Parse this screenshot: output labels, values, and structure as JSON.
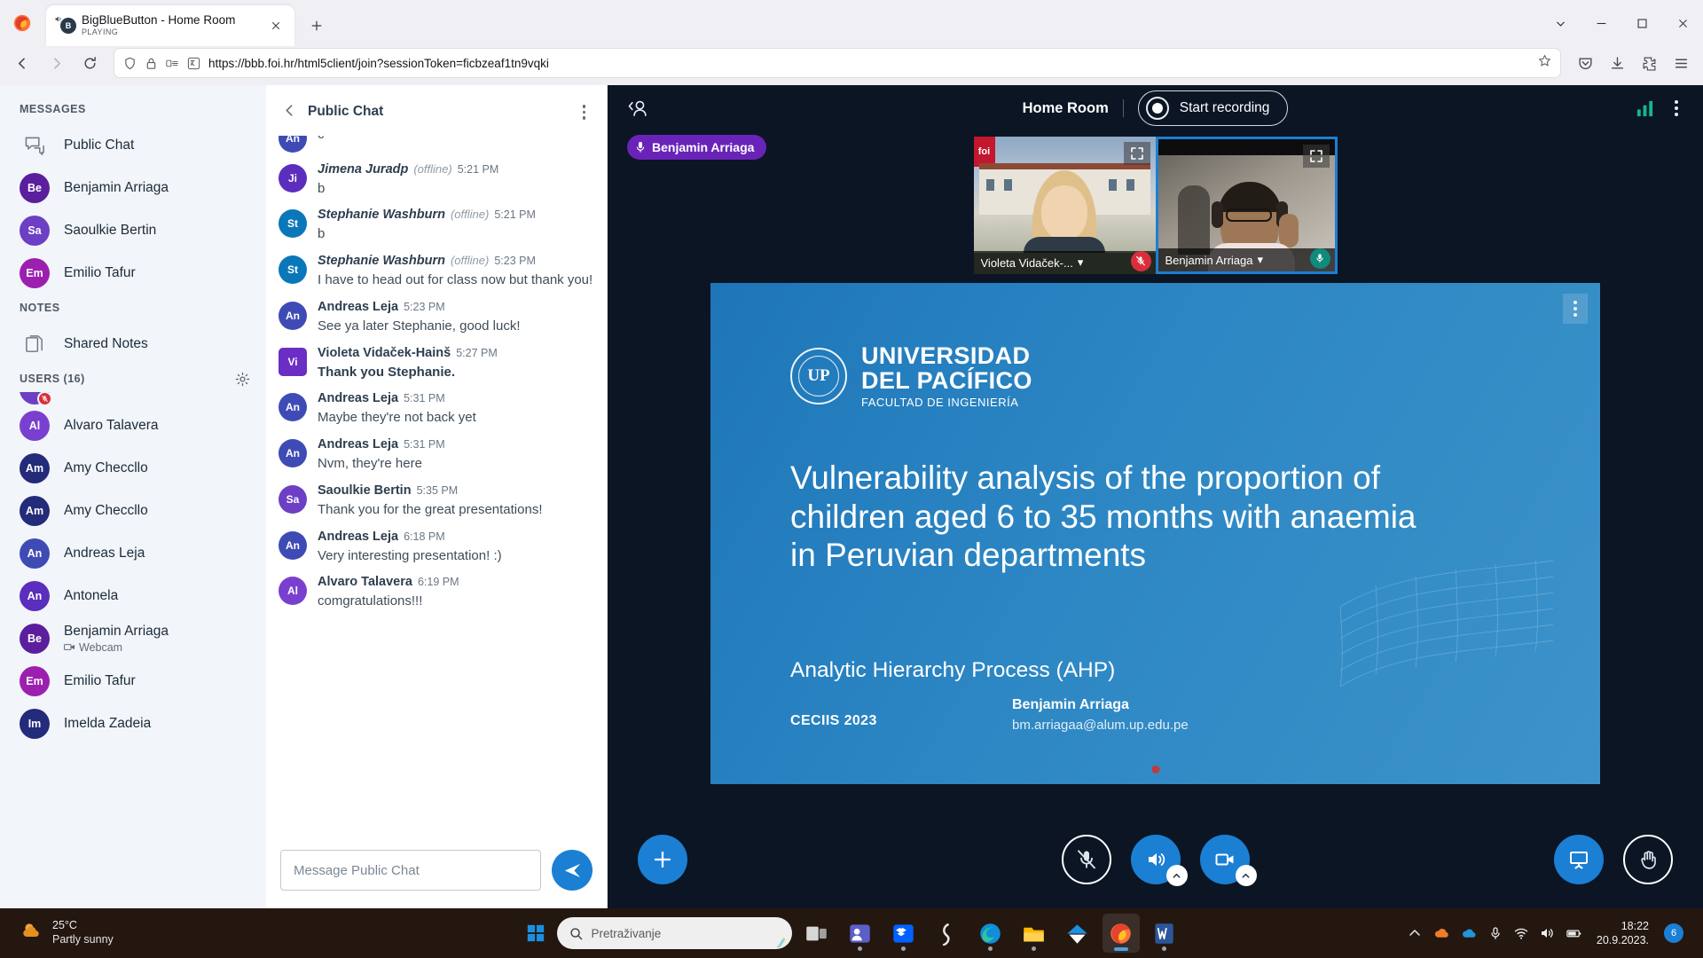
{
  "browser": {
    "tab": {
      "title": "BigBlueButton - Home Room",
      "status": "PLAYING",
      "favicon": "bbb-icon",
      "close": "close-icon"
    },
    "new_tab": "+",
    "window_controls": {
      "minimize": "minimize-icon",
      "maximize": "maximize-icon",
      "close": "close-icon",
      "tab_list": "chevron-down-icon"
    },
    "nav": {
      "back": "back-arrow-icon",
      "forward": "forward-arrow-icon",
      "reload": "reload-icon"
    },
    "url": "https://bbb.foi.hr/html5client/join?sessionToken=ficbzeaf1tn9vqki",
    "url_icons": {
      "shield": "shield-icon",
      "lock": "lock-icon",
      "extension": "extensions-icon",
      "translate": "translate-icon",
      "bookmark": "star-icon"
    },
    "toolbar_right": {
      "pocket": "save-to-pocket-icon",
      "downloads": "download-icon",
      "extensions": "puzzle-icon",
      "menu": "hamburger-menu-icon"
    }
  },
  "sidebar": {
    "messages_heading": "MESSAGES",
    "messages": [
      {
        "label": "Public Chat",
        "icon": "chat-bubbles-icon",
        "type": "icon"
      },
      {
        "label": "Benjamin Arriaga",
        "initials": "Be",
        "color": "#5b1f9e"
      },
      {
        "label": "Saoulkie Bertin",
        "initials": "Sa",
        "color": "#6c3fc4"
      },
      {
        "label": "Emilio Tafur",
        "initials": "Em",
        "color": "#9c1fb0"
      }
    ],
    "notes_heading": "NOTES",
    "notes": {
      "label": "Shared Notes",
      "icon": "documents-icon"
    },
    "users_heading": "USERS (16)",
    "users_settings_icon": "gear-icon",
    "users": [
      {
        "name": "",
        "initials": "",
        "color": "#6c3fc4",
        "status": "mute",
        "partial": true
      },
      {
        "name": "Alvaro Talavera",
        "initials": "Al",
        "color": "#7940cf",
        "status": "audio"
      },
      {
        "name": "Amy Checcllo",
        "initials": "Am",
        "color": "#232b7a",
        "status": "mute"
      },
      {
        "name": "Amy Checcllo",
        "initials": "Am",
        "color": "#232b7a",
        "status": "audio"
      },
      {
        "name": "Andreas Leja",
        "initials": "An",
        "color": "#3f4bb5",
        "status": "mute"
      },
      {
        "name": "Antonela",
        "initials": "An",
        "color": "#5b2ebd",
        "status": "mute"
      },
      {
        "name": "Benjamin Arriaga",
        "initials": "Be",
        "color": "#5b1f9e",
        "status": "audio",
        "presenter": true,
        "sub": "Webcam",
        "sub_icon": "webcam-icon"
      },
      {
        "name": "Emilio Tafur",
        "initials": "Em",
        "color": "#9c1fb0",
        "status": "mute"
      },
      {
        "name": "Imelda Zadeia",
        "initials": "Im",
        "color": "#232b7a",
        "status": "mute"
      }
    ]
  },
  "chat": {
    "back_icon": "chevron-left-icon",
    "title": "Public Chat",
    "options_icon": "kebab-menu-icon",
    "messages": [
      {
        "initials": "An",
        "color": "#3f4bb5",
        "name": "",
        "time": "",
        "text": "c",
        "partial": true
      },
      {
        "initials": "Ji",
        "color": "#5b2ebd",
        "name": "Jimena Juradp",
        "offline": "(offline)",
        "time": "5:21 PM",
        "text": "b"
      },
      {
        "initials": "St",
        "color": "#0a78b8",
        "name": "Stephanie Washburn",
        "offline": "(offline)",
        "time": "5:21 PM",
        "text": "b"
      },
      {
        "initials": "St",
        "color": "#0a78b8",
        "name": "Stephanie Washburn",
        "offline": "(offline)",
        "time": "5:23 PM",
        "text": "I have to head out for class now but thank you!"
      },
      {
        "initials": "An",
        "color": "#3f4bb5",
        "name": "Andreas Leja",
        "time": "5:23 PM",
        "text": "See ya later Stephanie, good luck!"
      },
      {
        "initials": "Vi",
        "color": "#6a2ec4",
        "square": true,
        "name": "Violeta Vidaček-Hainš",
        "time": "5:27 PM",
        "text": "Thank you Stephanie.",
        "bold": true
      },
      {
        "initials": "An",
        "color": "#3f4bb5",
        "name": "Andreas Leja",
        "time": "5:31 PM",
        "text": "Maybe they're not back yet"
      },
      {
        "initials": "An",
        "color": "#3f4bb5",
        "name": "Andreas Leja",
        "time": "5:31 PM",
        "text": "Nvm, they're here"
      },
      {
        "initials": "Sa",
        "color": "#6c3fc4",
        "name": "Saoulkie Bertin",
        "time": "5:35 PM",
        "text": "Thank you for the great presentations!"
      },
      {
        "initials": "An",
        "color": "#3f4bb5",
        "name": "Andreas Leja",
        "time": "6:18 PM",
        "text": "Very interesting presentation! :)"
      },
      {
        "initials": "Al",
        "color": "#7940cf",
        "name": "Alvaro Talavera",
        "time": "6:19 PM",
        "text": "comgratulations!!!"
      }
    ],
    "input_placeholder": "Message Public Chat",
    "input_value": "",
    "send_icon": "send-icon"
  },
  "meeting": {
    "back_icon": "collapse-userlist-icon",
    "room_name": "Home Room",
    "record_label": "Start recording",
    "record_icon": "record-circle-icon",
    "connection_icon": "connection-status-icon",
    "options_icon": "kebab-menu-icon",
    "talking_indicator": {
      "name": "Benjamin Arriaga",
      "icon": "microphone-icon"
    },
    "webcams": [
      {
        "name": "Violeta Vidaček-...",
        "mic": "off",
        "active": false,
        "expand_icon": "fullscreen-icon",
        "chevron": "chevron-down-icon"
      },
      {
        "name": "Benjamin Arriaga",
        "mic": "on",
        "active": true,
        "expand_icon": "fullscreen-icon",
        "chevron": "chevron-down-icon"
      }
    ],
    "actions": {
      "add_label": "+",
      "add_icon": "plus-icon",
      "mute_icon": "microphone-muted-icon",
      "audio_icon": "speaker-icon",
      "video_icon": "video-camera-icon",
      "presentation_icon": "presentation-icon",
      "raise_hand_icon": "raise-hand-icon",
      "caret_icon": "chevron-up-icon"
    }
  },
  "slide": {
    "options_icon": "kebab-menu-icon",
    "logo": {
      "line1": "UNIVERSIDAD",
      "line2": "DEL PACÍFICO",
      "line3": "FACULTAD DE INGENIERÍA",
      "seal_text": "UP"
    },
    "title": "Vulnerability analysis of the proportion of children aged 6 to 35 months with anaemia in Peruvian departments",
    "subtitle": "Analytic Hierarchy Process (AHP)",
    "conference": "CECIIS 2023",
    "author_name": "Benjamin Arriaga",
    "author_email": "bm.arriagaa@alum.up.edu.pe"
  },
  "taskbar": {
    "weather": {
      "temp": "25°C",
      "desc": "Partly sunny",
      "icon": "partly-sunny-icon"
    },
    "start_icon": "windows-start-icon",
    "search_placeholder": "Pretraživanje",
    "search_icon": "search-icon",
    "apps": [
      {
        "name": "task-view",
        "color": "#d6d6d6"
      },
      {
        "name": "teams",
        "color": "#5b5fc7"
      },
      {
        "name": "dropbox",
        "color": "#0061ff"
      },
      {
        "name": "slack",
        "color": "#e8e8e8"
      },
      {
        "name": "edge",
        "color": "#0f8fd8"
      },
      {
        "name": "file-explorer",
        "color": "#ffb900"
      },
      {
        "name": "onedrive",
        "color": "#0f8fd8"
      },
      {
        "name": "firefox",
        "color": "#ff7139",
        "active": true
      },
      {
        "name": "word",
        "color": "#2b579a"
      }
    ],
    "tray": {
      "overflow": "chevron-up-icon",
      "onedrive": "onedrive-icon",
      "mic": "microphone-icon",
      "wifi": "wifi-icon",
      "volume": "volume-icon",
      "battery": "battery-icon"
    },
    "clock_time": "18:22",
    "clock_date": "20.9.2023.",
    "notification_count": "6"
  }
}
